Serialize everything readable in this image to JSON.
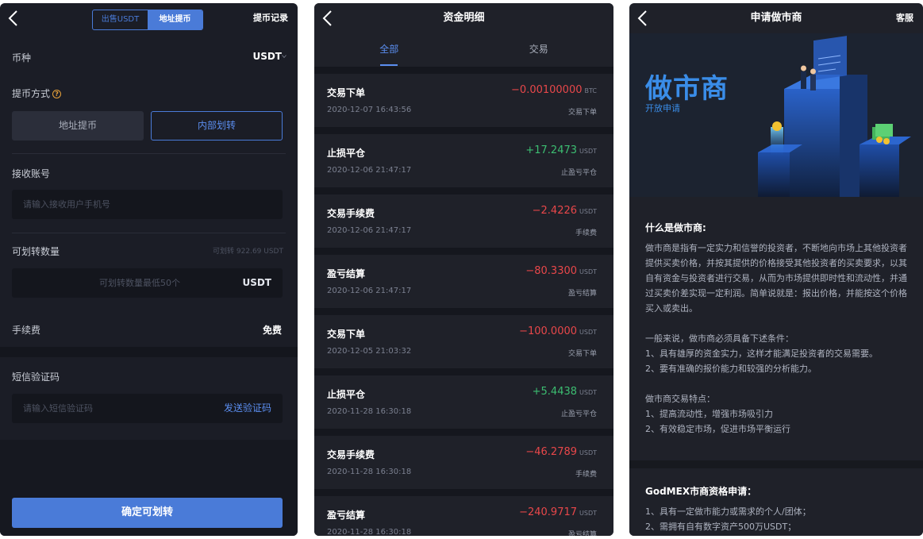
{
  "phone1": {
    "segment": {
      "left": "出售USDT",
      "right": "地址提币"
    },
    "nav_right": "提币记录",
    "coin_label": "币种",
    "coin_value": "USDT",
    "method_label": "提币方式",
    "method_hint": "?",
    "method_address": "地址提币",
    "method_internal": "内部划转",
    "account_label": "接收账号",
    "account_placeholder": "请输入接收用户手机号",
    "amount_label": "可划转数量",
    "amount_available": "可划转 922.69 USDT",
    "amount_placeholder": "可划转数量最低50个",
    "amount_unit": "USDT",
    "fee_label": "手续费",
    "fee_value": "免费",
    "sms_label": "短信验证码",
    "sms_placeholder": "请输入短信验证码",
    "sms_send": "发送验证码",
    "confirm": "确定可划转"
  },
  "phone2": {
    "title": "资金明细",
    "tabs": [
      "全部",
      "交易"
    ],
    "transactions": [
      {
        "title": "交易下单",
        "time": "2020-12-07 16:43:56",
        "amount": "−0.00100000",
        "unit": "BTC",
        "type": "交易下单",
        "sign": "neg"
      },
      {
        "title": "止损平仓",
        "time": "2020-12-06 21:47:17",
        "amount": "+17.2473",
        "unit": "USDT",
        "type": "止盈亏平仓",
        "sign": "pos"
      },
      {
        "title": "交易手续费",
        "time": "2020-12-06 21:47:17",
        "amount": "−2.4226",
        "unit": "USDT",
        "type": "手续费",
        "sign": "neg"
      },
      {
        "title": "盈亏结算",
        "time": "2020-12-06 21:47:17",
        "amount": "−80.3300",
        "unit": "USDT",
        "type": "盈亏结算",
        "sign": "neg"
      },
      {
        "title": "交易下单",
        "time": "2020-12-05 21:03:32",
        "amount": "−100.0000",
        "unit": "USDT",
        "type": "交易下单",
        "sign": "neg"
      },
      {
        "title": "止损平仓",
        "time": "2020-11-28 16:30:18",
        "amount": "+5.4438",
        "unit": "USDT",
        "type": "止盈亏平仓",
        "sign": "pos"
      },
      {
        "title": "交易手续费",
        "time": "2020-11-28 16:30:18",
        "amount": "−46.2789",
        "unit": "USDT",
        "type": "手续费",
        "sign": "neg"
      },
      {
        "title": "盈亏结算",
        "time": "2020-11-28 16:30:18",
        "amount": "−240.9717",
        "unit": "USDT",
        "type": "盈亏结算",
        "sign": "neg"
      }
    ]
  },
  "phone3": {
    "title": "申请做市商",
    "nav_right": "客服",
    "hero_title": "做市商",
    "hero_sub": "开放申请",
    "what_title": "什么是做市商:",
    "what_body": "做市商是指有一定实力和信誉的投资者，不断地向市场上其他投资者提供买卖价格，并按其提供的价格接受其他投资者的买卖要求，以其自有资金与投资者进行交易，从而为市场提供即时性和流动性，并通过买卖价差实现一定利润。简单说就是：报出价格，并能按这个价格买入或卖出。",
    "cond_intro": "一般来说，做市商必须具备下述条件：",
    "cond_1": "1、具有雄厚的资金实力，这样才能满足投资者的交易需要。",
    "cond_2": "2、要有准确的报价能力和较强的分析能力。",
    "feat_intro": "做市商交易特点：",
    "feat_1": "1、提高流动性，增强市场吸引力",
    "feat_2": "2、有效稳定市场，促进市场平衡运行",
    "apply_title": "GodMEX市商资格申请：",
    "apply_1": "1、具有一定做市能力或需求的个人/团体；",
    "apply_2": "2、需拥有自有数字资产500万USDT；"
  },
  "colors": {
    "accent": "#4a7bd8",
    "link": "#5b8ef0",
    "negative": "#e8474a",
    "positive": "#3cbd71",
    "warning": "#e8a23a"
  },
  "icons": [
    "back-arrow-icon",
    "chevron-down-icon",
    "question-circle-icon",
    "market-maker-illustration"
  ]
}
